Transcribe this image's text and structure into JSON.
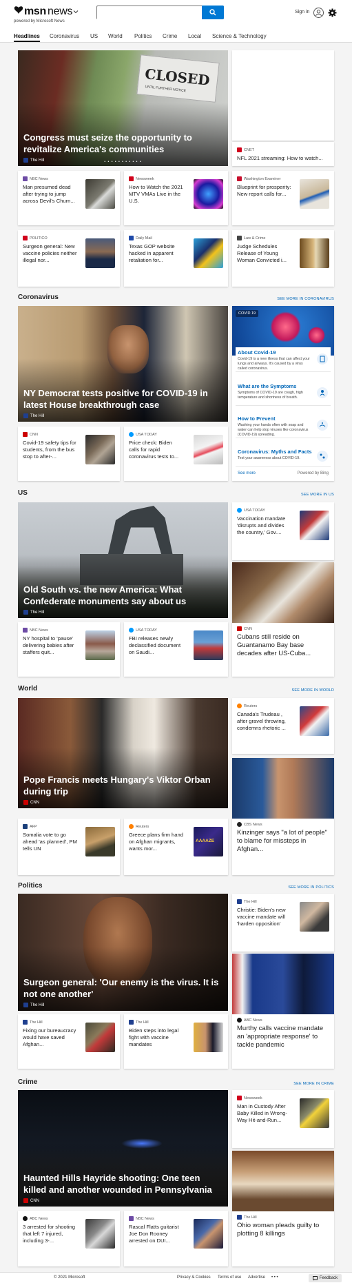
{
  "header": {
    "logo_text": "msn",
    "logo_news": "news",
    "powered_by": "powered by Microsoft News",
    "search_placeholder": "",
    "signin": "Sign in"
  },
  "nav": [
    "Headlines",
    "Coronavirus",
    "US",
    "World",
    "Politics",
    "Crime",
    "Local",
    "Science & Technology"
  ],
  "headlines": {
    "hero": {
      "title": "Congress must seize the opportunity to revitalize America's communities",
      "source": "The Hill",
      "sign_text": "CLOSED",
      "sign_sub": "UNTIL FURTHER NOTICE",
      "dots": "• • • • • • • • • • •"
    },
    "side_top_source": "CNET",
    "side_top_title": "NFL 2021 streaming: How to watch...",
    "row1": [
      {
        "source": "NBC News",
        "title": "Man presumed dead after trying to jump across Devil's Churn...",
        "color": "#6d4ba5"
      },
      {
        "source": "Newsweek",
        "title": "How to Watch the 2021 MTV VMAs Live in the U.S.",
        "color": "#d0021b"
      },
      {
        "source": "Washington Examiner",
        "title": "Blueprint for prosperity: New report calls for...",
        "color": "#c8102e"
      }
    ],
    "row2": [
      {
        "source": "POLITICO",
        "title": "Surgeon general: New vaccine policies neither illegal nor...",
        "color": "#d0021b"
      },
      {
        "source": "Daily Mail",
        "title": "Texas GOP website hacked in apparent retaliation for...",
        "color": "#1f4aa8"
      },
      {
        "source": "Law & Crime",
        "title": "Judge Schedules Release of Young Woman Convicted i...",
        "color": "#444444"
      }
    ]
  },
  "coronavirus": {
    "label": "Coronavirus",
    "more": "SEE MORE IN CORONAVIRUS",
    "hero": {
      "title": "NY Democrat tests positive for COVID-19 in latest House breakthrough case",
      "source": "The Hill"
    },
    "row": [
      {
        "source": "CNN",
        "title": "Covid-19 safety tips for students, from the bus stop to after-...",
        "color": "#cc0000"
      },
      {
        "source": "USA TODAY",
        "title": "Price check: Biden calls for rapid coronavirus tests to...",
        "color": "#009bff"
      }
    ],
    "panel": {
      "badge": "COVID 19",
      "items": [
        {
          "title": "About Covid-19",
          "desc": "Covid-19 is a new illness that can affect your lungs and airways. It's caused by a virus called coronavirus."
        },
        {
          "title": "What are the Symptoms",
          "desc": "Symptoms of COVID-19 are cough, high temperature and shortness of breath."
        },
        {
          "title": "How to Prevent",
          "desc": "Washing your hands often with soap and water can help stop viruses like coronavirus (COVID-19) spreading."
        },
        {
          "title": "Coronavirus: Myths and Facts",
          "desc": "Test your awareness about COVID-19."
        }
      ],
      "see_more": "See more",
      "powered": "Powered by Bing"
    }
  },
  "us": {
    "label": "US",
    "more": "SEE MORE IN US",
    "hero": {
      "title": "Old South vs. the new America: What Confederate monuments say about us",
      "source": "The Hill"
    },
    "side": {
      "source": "USA TODAY",
      "title": "Vaccination mandate 'disrupts and divides the country,' Gov....",
      "color": "#009bff"
    },
    "img_card": {
      "source": "CNN",
      "title": "Cubans still reside on Guantanamo Bay base decades after US-Cuba...",
      "color": "#cc0000"
    },
    "row": [
      {
        "source": "NBC News",
        "title": "NY hospital to 'pause' delivering babies after staffers quit...",
        "color": "#6d4ba5"
      },
      {
        "source": "USA TODAY",
        "title": "FBI releases newly declassified document on Saudi...",
        "color": "#009bff"
      }
    ]
  },
  "world": {
    "label": "World",
    "more": "SEE MORE IN WORLD",
    "hero": {
      "title": "Pope Francis meets Hungary's Viktor Orban during trip",
      "source": "CNN"
    },
    "side": {
      "source": "Reuters",
      "title": "Canada's Trudeau , after gravel throwing, condemns rhetoric ...",
      "color": "#ff8000"
    },
    "img_card": {
      "source": "CBS News",
      "title": "Kinzinger says \"a lot of people\" to blame for missteps in Afghan...",
      "color": "#222222"
    },
    "row": [
      {
        "source": "AFP",
        "title": "Somalia vote to go ahead 'as planned', PM tells UN",
        "color": "#1a3f7a"
      },
      {
        "source": "Reuters",
        "title": "Greece plans firm hand on Afghan migrants, wants mor...",
        "color": "#ff8000"
      }
    ],
    "row_thumb_text": "AAAAZE"
  },
  "politics": {
    "label": "Politics",
    "more": "SEE MORE IN POLITICS",
    "hero": {
      "title": "Surgeon general: 'Our enemy is the virus. It is not one another'",
      "source": "The Hill"
    },
    "side": {
      "source": "The Hill",
      "title": "Christie: Biden's new vaccine mandate will 'harden opposition'",
      "color": "#1f3f8f"
    },
    "img_card": {
      "source": "ABC News",
      "title": "Murthy calls vaccine mandate an 'appropriate response' to tackle pandemic",
      "color": "#111111"
    },
    "row": [
      {
        "source": "The Hill",
        "title": "Fixing our bureaucracy would have saved Afghan...",
        "color": "#1f3f8f"
      },
      {
        "source": "The Hill",
        "title": "Biden steps into legal fight with vaccine mandates",
        "color": "#1f3f8f"
      }
    ]
  },
  "crime": {
    "label": "Crime",
    "more": "SEE MORE IN CRIME",
    "hero": {
      "title": "Haunted Hills Hayride shooting: One teen killed and another wounded in Pennsylvania",
      "source": "CNN"
    },
    "side": {
      "source": "Newsweek",
      "title": "Man in Custody After Baby Killed in Wrong-Way Hit-and-Run...",
      "color": "#d0021b"
    },
    "img_card": {
      "source": "The Hill",
      "title": "Ohio woman pleads guilty to plotting 8 killings",
      "color": "#1f3f8f"
    },
    "row": [
      {
        "source": "ABC News",
        "title": "3 arrested for shooting that left 7 injured, including 3-...",
        "color": "#111111"
      },
      {
        "source": "NBC News",
        "title": "Rascal Flatts guitarist Joe Don Rooney arrested on DUI...",
        "color": "#6d4ba5"
      }
    ]
  },
  "footer": {
    "copyright": "© 2021 Microsoft",
    "privacy": "Privacy & Cookies",
    "terms": "Terms of use",
    "advertise": "Advertise",
    "ellipsis": "• • •",
    "feedback": "Feedback"
  }
}
